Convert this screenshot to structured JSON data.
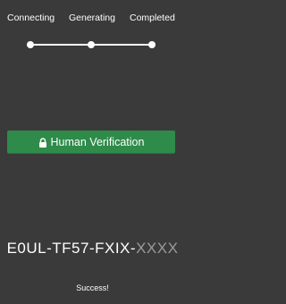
{
  "progress": {
    "steps": [
      {
        "label": "Connecting"
      },
      {
        "label": "Generating"
      },
      {
        "label": "Completed"
      }
    ]
  },
  "verify_button": {
    "label": "Human Verification",
    "icon": "lock-icon",
    "color": "#2e8b4a"
  },
  "code": {
    "visible": "E0UL-TF57-FXIX-",
    "masked": "XXXX"
  },
  "status": "Success!",
  "colors": {
    "background": "#3a3a3a",
    "accent": "#2e8b4a",
    "masked_text": "#9a9a9a"
  }
}
